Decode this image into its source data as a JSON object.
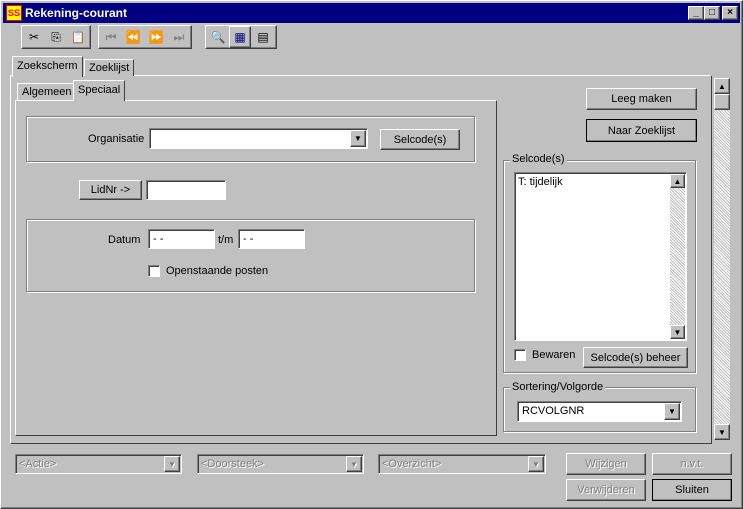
{
  "window": {
    "title": "Rekening-courant",
    "app_icon_text": "SS",
    "caption_buttons": [
      "_",
      "□",
      "×"
    ]
  },
  "toolbar": {
    "cut": "✂",
    "copy": "⎘",
    "paste": "📋",
    "first": "⏮",
    "prev": "⏪",
    "next": "⏩",
    "last": "⏭",
    "search": "🔍",
    "grid": "▦",
    "form": "▤"
  },
  "tabs": {
    "outer": [
      {
        "label": "Zoekscherm"
      },
      {
        "label": "Zoeklijst"
      }
    ],
    "inner": [
      {
        "label": "Algemeen"
      },
      {
        "label": "Speciaal"
      }
    ]
  },
  "form": {
    "organisatie_label": "Organisatie",
    "organisatie_value": "",
    "selcode_button": "Selcode(s)",
    "lidnr_button": "LidNr ->",
    "lidnr_value": "",
    "datum_label": "Datum",
    "datum_from": " -  -",
    "datum_tm_label": "t/m",
    "datum_to": " -  -",
    "openstaande_label": "Openstaande posten"
  },
  "right_panel": {
    "leeg_button": "Leeg maken",
    "naar_zoeklijst_button": "Naar Zoeklijst",
    "selcodes_group": "Selcode(s)",
    "selcodes_items": [
      "T: tijdelijk"
    ],
    "bewaren_label": "Bewaren",
    "beheer_button": "Selcode(s) beheer",
    "sortering_group": "Sortering/Volgorde",
    "sortering_value": "RCVOLGNR"
  },
  "bottom": {
    "actie": "<Actie>",
    "doorsteek": "<Doorsteek>",
    "overzicht": "<Overzicht>",
    "wijzigen": "Wijzigen",
    "nvt": "n.v.t.",
    "verwijderen": "Verwijderen",
    "sluiten": "Sluiten"
  }
}
